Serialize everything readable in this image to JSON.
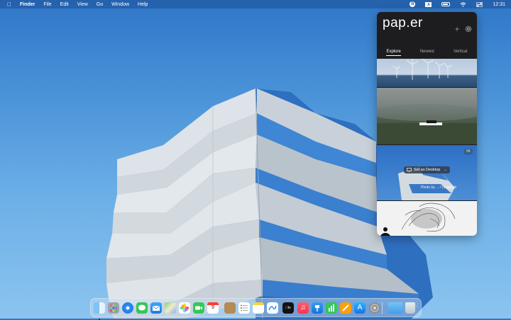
{
  "menubar": {
    "apple_icon": "apple-icon",
    "app_name": "Finder",
    "menus": [
      "File",
      "Edit",
      "View",
      "Go",
      "Window",
      "Help"
    ],
    "status_icons": [
      "paper-status-icon",
      "input-source-icon",
      "battery-icon",
      "wifi-icon",
      "control-center-icon"
    ],
    "input_source": "A",
    "paper_badge": "B",
    "time": "12:31"
  },
  "popup": {
    "logo": "pap.er",
    "tabs": [
      {
        "label": "Explore",
        "active": true
      },
      {
        "label": "Newest",
        "active": false
      },
      {
        "label": "Vertical",
        "active": false
      }
    ],
    "photos": [
      {
        "subject": "wind turbines over sea"
      },
      {
        "subject": "foggy green field with barn"
      },
      {
        "subject": "blue building",
        "badge": "5K",
        "action": "Set as Desktop",
        "credit": "Photo by ... / Unsplash"
      },
      {
        "subject": "black and white illustration"
      }
    ]
  },
  "dock": {
    "apps": [
      "finder-icon",
      "launchpad-icon",
      "safari-icon",
      "messages-icon",
      "mail-icon",
      "maps-icon",
      "photos-icon",
      "facetime-icon",
      "calendar-icon",
      "notes-brown-icon",
      "reminders-icon",
      "notes-icon",
      "freeform-icon",
      "appletv-icon",
      "music-icon",
      "keynote-icon",
      "numbers-icon",
      "pages-icon",
      "appstore-icon",
      "systemsettings-icon"
    ],
    "calendar_day": "9",
    "extras": [
      "downloads-folder-icon",
      "trash-icon"
    ]
  },
  "colors": {
    "sky_top": "#2f77c8",
    "sky_bottom": "#8cc4ef",
    "glass_blue": "#2f6fc0",
    "concrete": "#c9d2da",
    "popup_bg": "#1d1d1f"
  }
}
